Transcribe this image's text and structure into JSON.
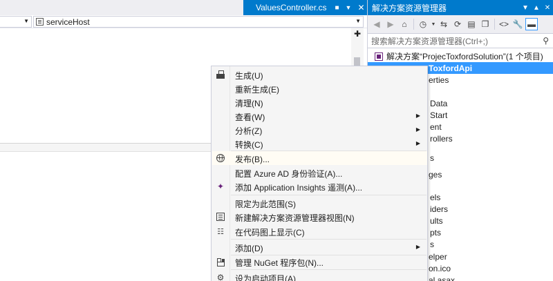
{
  "editor": {
    "tab": {
      "title": "ValuesController.cs"
    },
    "nav": {
      "right_value": "serviceHost"
    }
  },
  "solution_explorer": {
    "title": "解决方案资源管理器",
    "search_placeholder": "搜索解决方案资源管理器(Ctrl+;)",
    "tree": [
      {
        "label": "解决方案“ProjecToxfordSolution”(1 个项目)",
        "kind": "solution"
      },
      {
        "label": "ToxfordApi",
        "kind": "project",
        "selected": true
      },
      {
        "label": "erties"
      },
      {
        "label": "Data"
      },
      {
        "label": "Start"
      },
      {
        "label": "ent"
      },
      {
        "label": "rollers"
      },
      {
        "label": "s"
      },
      {
        "label": "ges"
      },
      {
        "label": "els"
      },
      {
        "label": "iders"
      },
      {
        "label": "ults"
      },
      {
        "label": "pts"
      },
      {
        "label": "s"
      },
      {
        "label": "elper"
      },
      {
        "label": "on.ico"
      },
      {
        "label": "al.asax"
      }
    ]
  },
  "context_menu": {
    "items": [
      {
        "label": "生成(U)",
        "icon": "build-icon"
      },
      {
        "label": "重新生成(E)"
      },
      {
        "label": "清理(N)"
      },
      {
        "label": "查看(W)",
        "submenu": true
      },
      {
        "label": "分析(Z)",
        "submenu": true
      },
      {
        "label": "转换(C)",
        "submenu": true
      },
      {
        "label": "发布(B)...",
        "icon": "globe-icon",
        "highlighted": true
      },
      {
        "label": "配置 Azure AD 身份验证(A)..."
      },
      {
        "label": "添加 Application Insights 遥测(A)...",
        "icon": "application-insights-icon"
      },
      {
        "label": "限定为此范围(S)"
      },
      {
        "label": "新建解决方案资源管理器视图(N)",
        "icon": "new-view-icon"
      },
      {
        "label": "在代码图上显示(C)",
        "icon": "code-map-icon"
      },
      {
        "label": "添加(D)",
        "submenu": true
      },
      {
        "label": "管理 NuGet 程序包(N)...",
        "icon": "nuget-icon"
      },
      {
        "label": "设为启动项目(A)",
        "icon": "gear-icon"
      }
    ]
  }
}
